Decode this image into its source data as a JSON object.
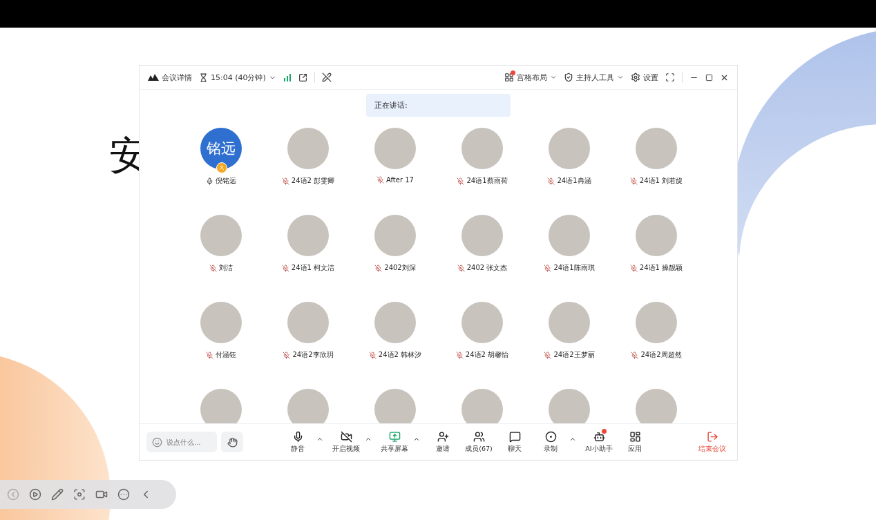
{
  "backdrop": {
    "glyph": "安"
  },
  "window": {
    "title": "会议详情",
    "timer": "15:04 (40分钟)",
    "right_tools": [
      {
        "kind": "layout",
        "label": "宫格布局",
        "badge": true,
        "caret": true
      },
      {
        "kind": "host",
        "label": "主持人工具",
        "badge": false,
        "caret": true
      },
      {
        "kind": "settings",
        "label": "设置",
        "badge": false,
        "caret": false
      }
    ]
  },
  "speaking": {
    "label": "正在讲话:"
  },
  "participants": [
    {
      "name": "倪铭远",
      "avatar_text": "铭远",
      "kind": "text",
      "muted": false,
      "host": true
    },
    {
      "name": "24语2 彭雯卿",
      "kind": "photo",
      "muted": true,
      "host": false
    },
    {
      "name": "After 17",
      "kind": "photo",
      "muted": true,
      "host": false
    },
    {
      "name": "24语1蔡雨荷",
      "kind": "photo",
      "muted": true,
      "host": false
    },
    {
      "name": "24语1冉涵",
      "kind": "photo",
      "muted": true,
      "host": false
    },
    {
      "name": "24语1 刘若旋",
      "kind": "photo",
      "muted": true,
      "host": false
    },
    {
      "name": "刘洁",
      "kind": "photo",
      "muted": true,
      "host": false
    },
    {
      "name": "24语1 柯文洁",
      "kind": "photo",
      "muted": true,
      "host": false
    },
    {
      "name": "2402刘深",
      "kind": "photo",
      "muted": true,
      "host": false
    },
    {
      "name": "2402 张文杰",
      "kind": "photo",
      "muted": true,
      "host": false
    },
    {
      "name": "24语1陈雨琪",
      "kind": "photo",
      "muted": true,
      "host": false
    },
    {
      "name": "24语1 操靓颖",
      "kind": "photo",
      "muted": true,
      "host": false
    },
    {
      "name": "付涵钰",
      "kind": "photo",
      "muted": true,
      "host": false
    },
    {
      "name": "24语2李欣玥",
      "kind": "photo",
      "muted": true,
      "host": false
    },
    {
      "name": "24语2 韩林汐",
      "kind": "photo",
      "muted": true,
      "host": false
    },
    {
      "name": "24语2 胡馨怡",
      "kind": "photo",
      "muted": true,
      "host": false
    },
    {
      "name": "24语2王梦丽",
      "kind": "photo",
      "muted": true,
      "host": false
    },
    {
      "name": "24语2周超然",
      "kind": "photo",
      "muted": true,
      "host": false
    },
    {
      "kind": "photo",
      "host": false
    },
    {
      "kind": "photo",
      "host": false
    },
    {
      "kind": "photo",
      "host": false
    },
    {
      "kind": "photo",
      "host": false
    },
    {
      "kind": "photo",
      "host": false
    },
    {
      "kind": "photo",
      "host": false
    }
  ],
  "chat_input": {
    "placeholder": "说点什么..."
  },
  "toolbar": [
    {
      "kind": "mic",
      "label": "静音",
      "caret": true,
      "badge": false
    },
    {
      "kind": "video_off",
      "label": "开启视频",
      "caret": true,
      "badge": false
    },
    {
      "kind": "share",
      "label": "共享屏幕",
      "caret": true,
      "badge": false
    },
    {
      "kind": "invite",
      "label": "邀请",
      "caret": false,
      "badge": false
    },
    {
      "kind": "members",
      "label": "成员(67)",
      "caret": false,
      "badge": false
    },
    {
      "kind": "chat",
      "label": "聊天",
      "caret": false,
      "badge": false
    },
    {
      "kind": "record",
      "label": "录制",
      "caret": true,
      "badge": false
    },
    {
      "kind": "assistant",
      "label": "AI小助手",
      "caret": false,
      "badge": true
    },
    {
      "kind": "apps",
      "label": "应用",
      "caret": false,
      "badge": false
    }
  ],
  "end_button": {
    "label": "结束会议"
  },
  "presenter_bar": [
    {
      "kind": "prev",
      "disabled": true
    },
    {
      "kind": "play",
      "disabled": false
    },
    {
      "kind": "pen",
      "disabled": false
    },
    {
      "kind": "focus",
      "disabled": false
    },
    {
      "kind": "camera",
      "disabled": false
    },
    {
      "kind": "more",
      "disabled": false
    },
    {
      "kind": "collapse",
      "disabled": false
    }
  ]
}
